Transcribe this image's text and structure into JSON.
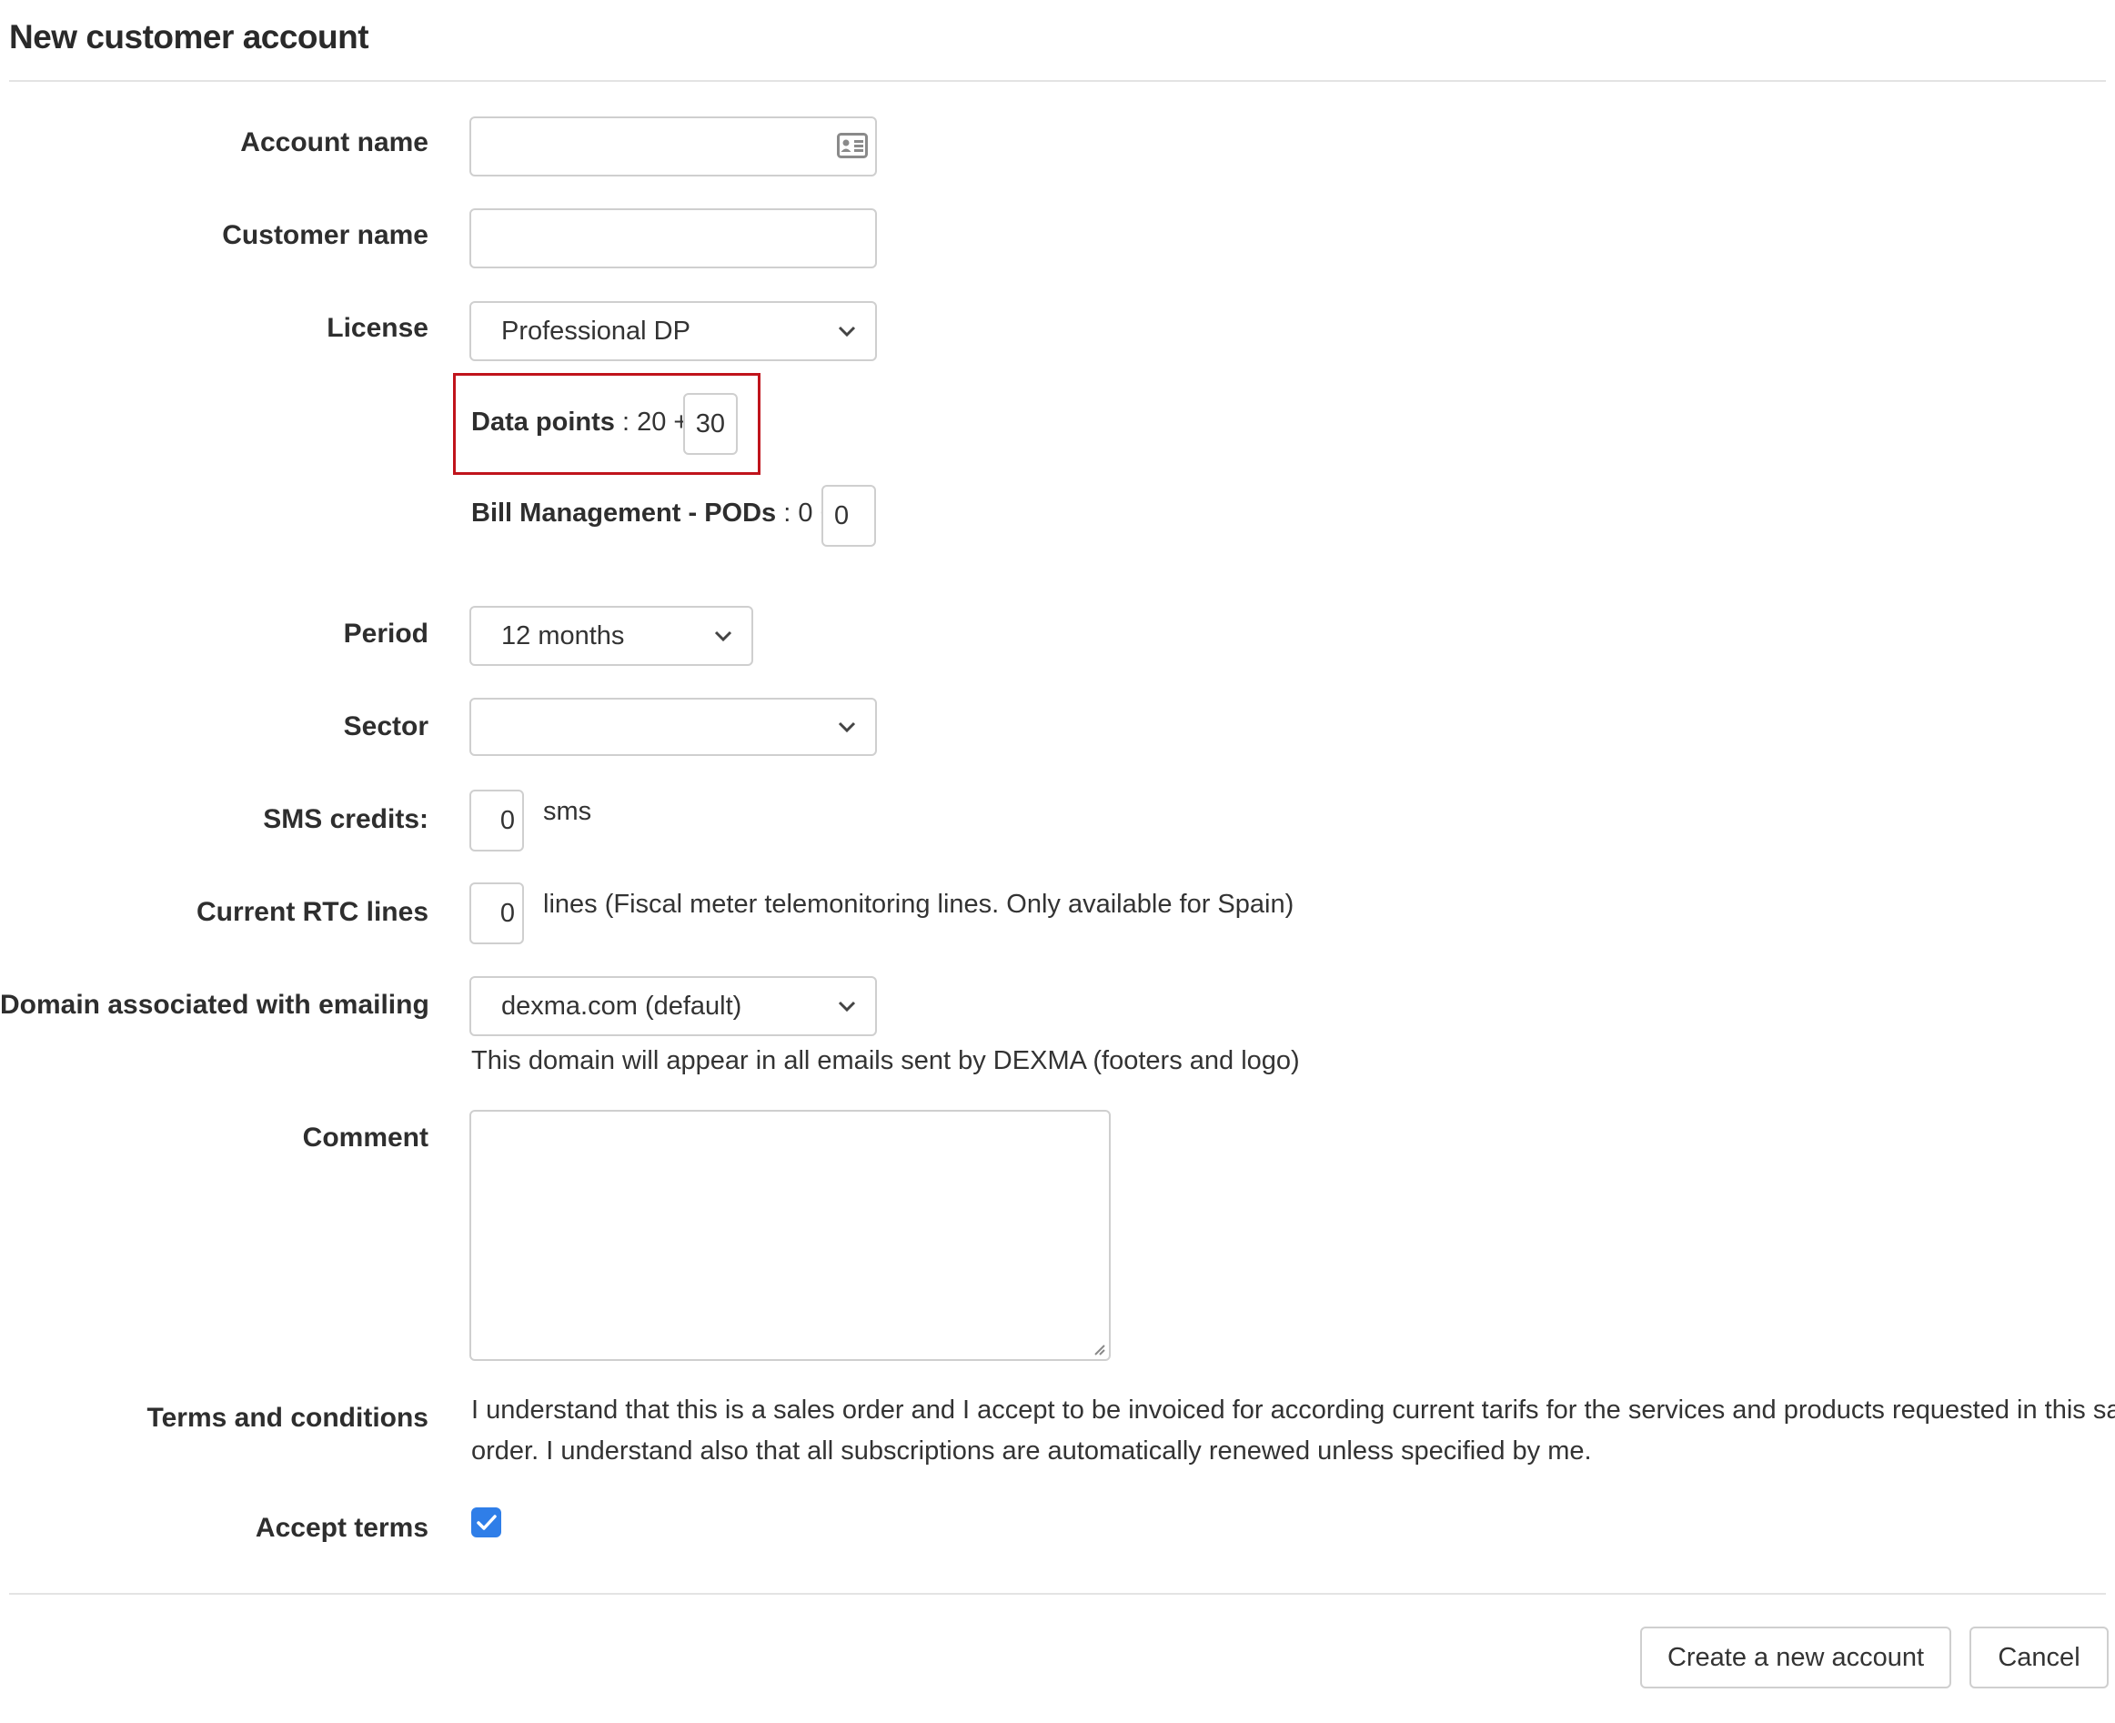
{
  "page": {
    "title": "New customer account"
  },
  "form": {
    "account_name": {
      "label": "Account name",
      "value": "",
      "icon": "contact-card-icon"
    },
    "customer_name": {
      "label": "Customer name",
      "value": ""
    },
    "license": {
      "label": "License",
      "value": "Professional DP"
    },
    "data_points": {
      "label": "Data points",
      "base": " : 20 + ",
      "value": "30",
      "highlight_color": "#c0141c"
    },
    "bill_management": {
      "label": "Bill Management - PODs",
      "base": " : 0 + ",
      "value": "0"
    },
    "period": {
      "label": "Period",
      "value": "12 months"
    },
    "sector": {
      "label": "Sector",
      "value": ""
    },
    "sms_credits": {
      "label": "SMS credits:",
      "value": "0",
      "unit": "sms"
    },
    "rtc_lines": {
      "label": "Current RTC lines",
      "value": "0",
      "unit": "lines (Fiscal meter telemonitoring lines. Only available for Spain)"
    },
    "domain": {
      "label": "Domain associated with emailing",
      "value": "dexma.com (default)",
      "help": "This domain will appear in all emails sent by DEXMA (footers and logo)"
    },
    "comment": {
      "label": "Comment",
      "value": ""
    },
    "terms": {
      "label": "Terms and conditions",
      "line1": "I understand that this is a sales order and I accept to be invoiced for according current tarifs for the services and products requested in this sales",
      "line2": "order. I understand also that all subscriptions are automatically renewed unless specified by me."
    },
    "accept_terms": {
      "label": "Accept terms",
      "checked": true,
      "color": "#2f7ee8"
    }
  },
  "actions": {
    "create_label": "Create a new account",
    "cancel_label": "Cancel"
  }
}
